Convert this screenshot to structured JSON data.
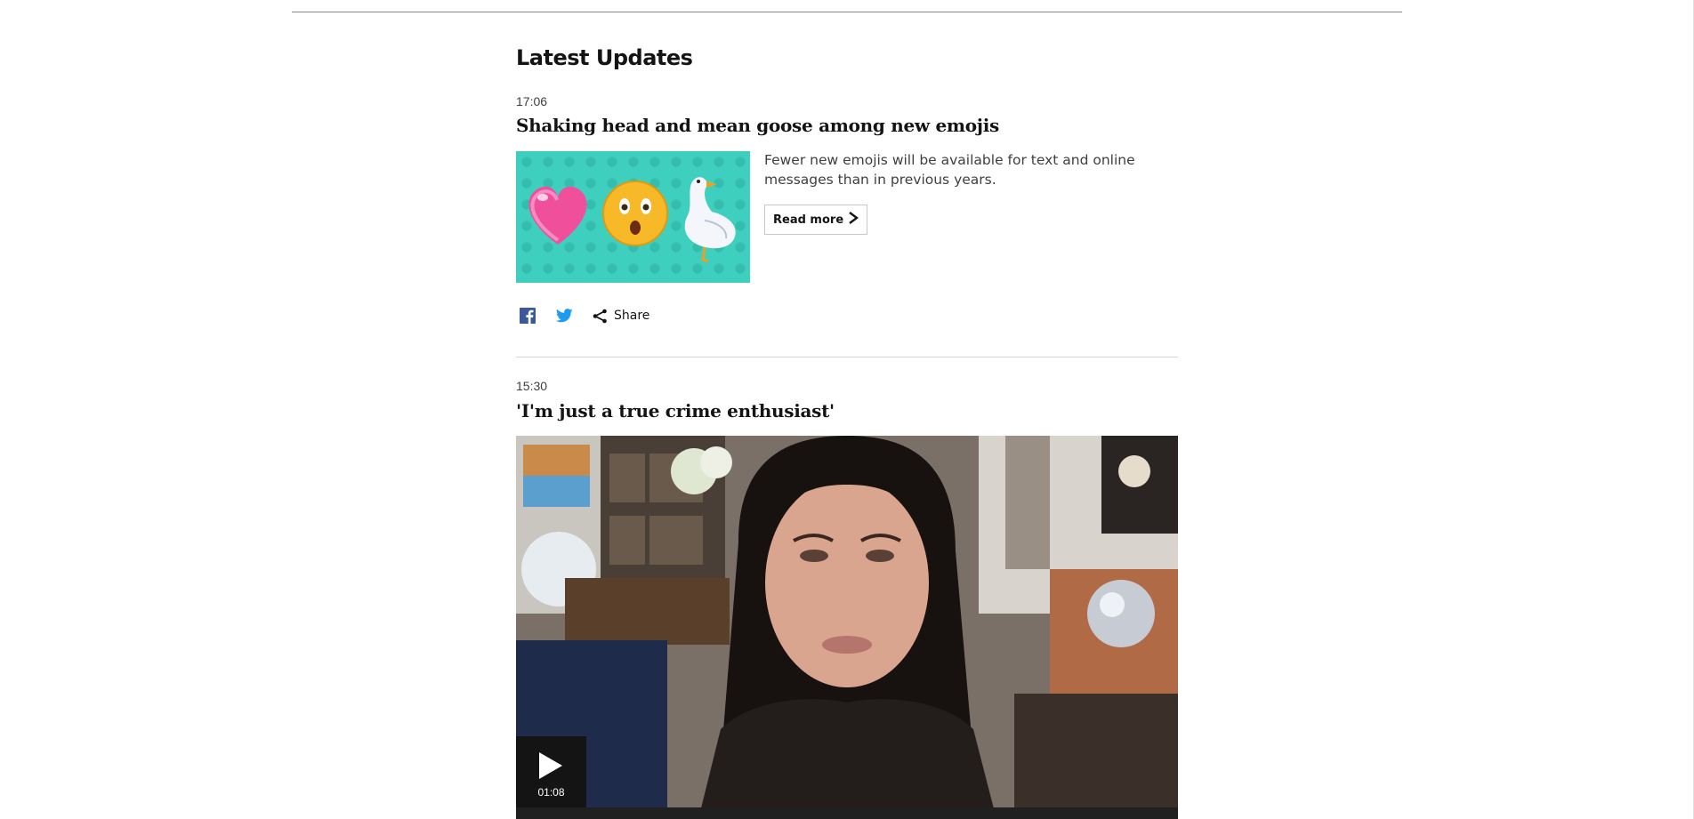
{
  "section": {
    "title": "Latest Updates"
  },
  "posts": [
    {
      "time": "17:06",
      "headline": "Shaking head and mean goose among new emojis",
      "summary": "Fewer new emojis will be available for text and online messages than in previous years.",
      "read_more_label": "Read more",
      "share_label": "Share"
    },
    {
      "time": "15:30",
      "headline": "'I'm just a true crime enthusiast'",
      "video_duration": "01:08"
    }
  ],
  "colors": {
    "facebook": "#3b5998",
    "twitter": "#1d9bf0",
    "emoji_bg": "#3fcfbf"
  }
}
